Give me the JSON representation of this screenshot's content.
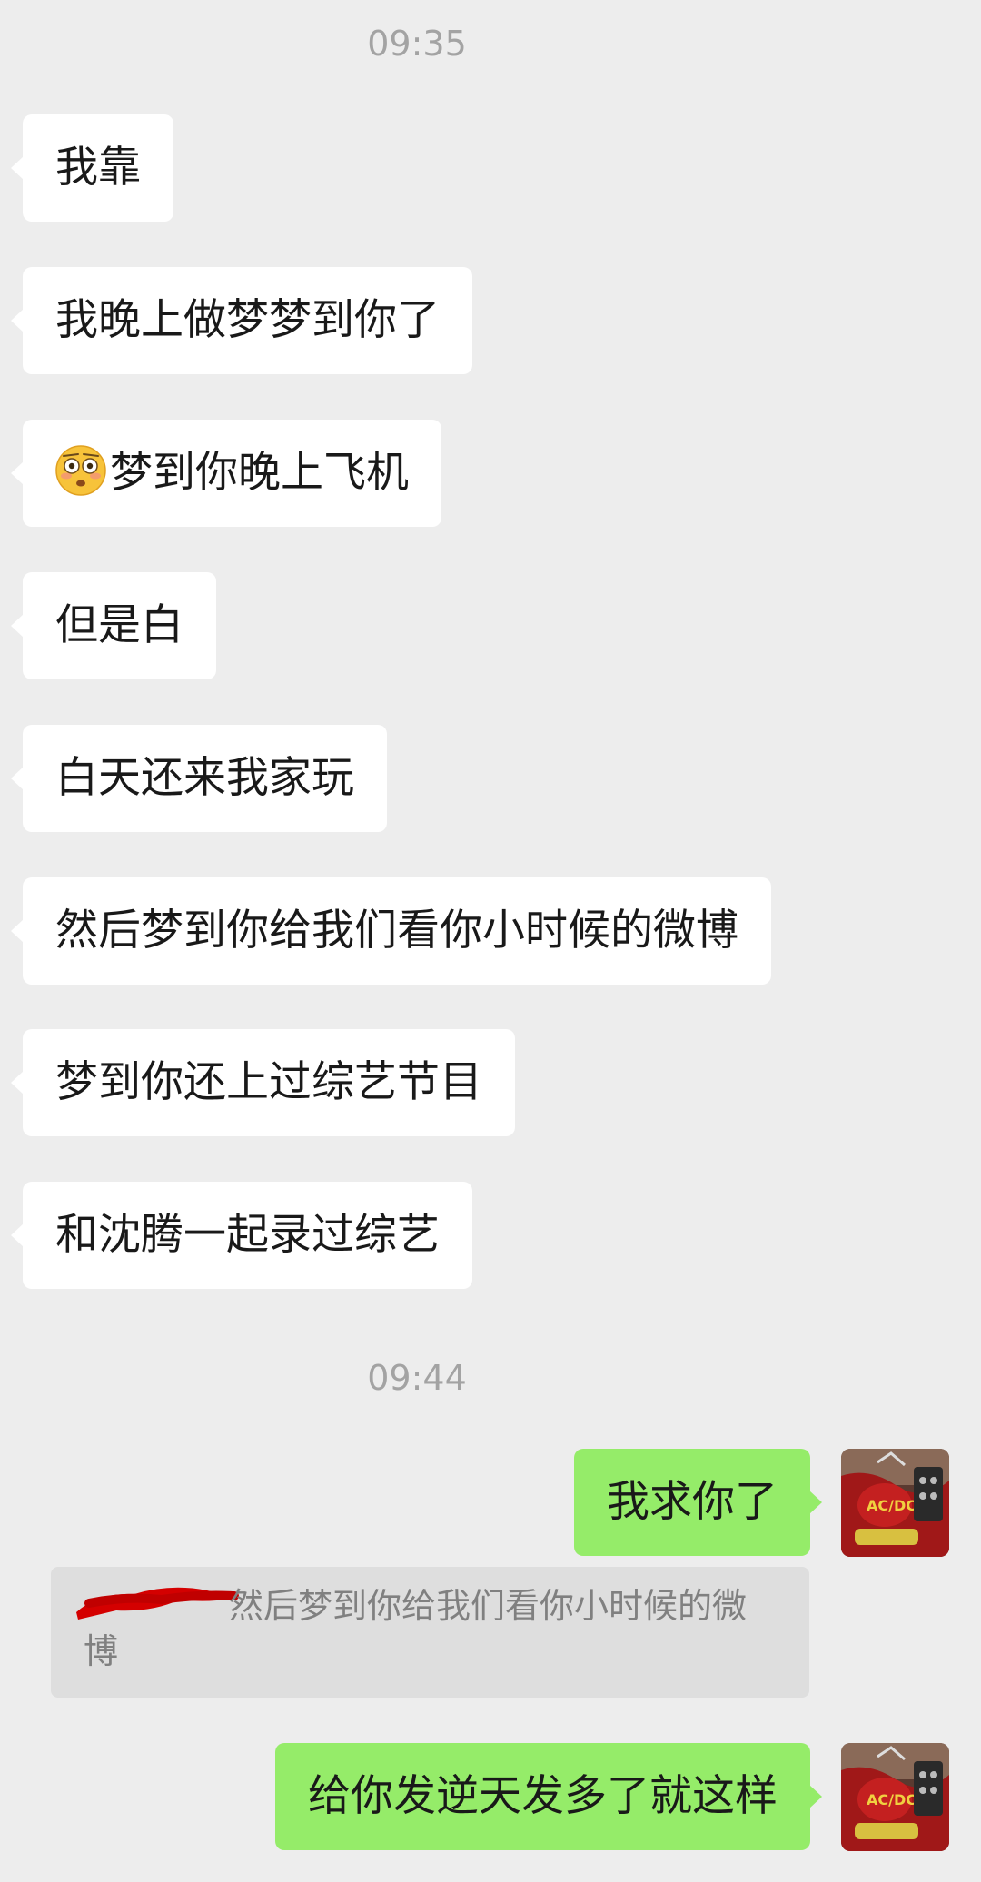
{
  "chat": {
    "timestamp_1": "09:35",
    "timestamp_2": "09:44",
    "incoming": [
      "我靠",
      "我晚上做梦梦到你了",
      "梦到你晚上飞机",
      "但是白",
      "白天还来我家玩",
      "然后梦到你给我们看你小时候的微博",
      "梦到你还上过综艺节目",
      "和沈腾一起录过综艺"
    ],
    "incoming_3_emoji": "flushed-face-emoji",
    "outgoing": [
      "我求你了",
      "给你发逆天发多了就这样"
    ],
    "quote": {
      "text": "然后梦到你给我们看你小时候的微博",
      "sender_redacted": true
    }
  },
  "colors": {
    "background": "#ededed",
    "incoming_bubble": "#ffffff",
    "outgoing_bubble": "#95ec69",
    "quote_background": "#dedede",
    "redaction": "#d40000"
  }
}
